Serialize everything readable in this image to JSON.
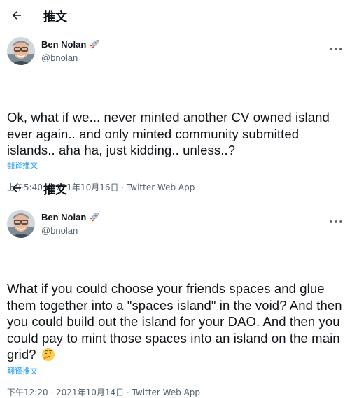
{
  "tweets": [
    {
      "header_title": "推文",
      "author_name": "Ben Nolan",
      "author_handle": "@bnolan",
      "author_badge_icon": "rocket-icon",
      "text": "Ok, what if we... never minted another CV owned island ever again.. and only minted community submitted islands.. aha ha, just kidding.. unless..?",
      "translate_label": "翻译推文",
      "timestamp": "上午5:40 · 2021年10月16日 · ",
      "app_name": "Twitter Web App"
    },
    {
      "header_title": "推文",
      "author_name": "Ben Nolan",
      "author_handle": "@bnolan",
      "author_badge_icon": "rocket-icon",
      "text": "What if you could choose your friends spaces and glue them together into a \"spaces island\" in the void? And then you could build out the island for your DAO. And then you could pay to mint those spaces into an island on the main grid?",
      "trailing_emoji": "thinking-face-emoji",
      "translate_label": "翻译推文",
      "timestamp": "下午12:20 · 2021年10月14日 · ",
      "app_name": "Twitter Web App"
    }
  ],
  "colors": {
    "link": "#1d9bf0",
    "secondary_text": "#536471",
    "primary_text": "#0f1419"
  }
}
